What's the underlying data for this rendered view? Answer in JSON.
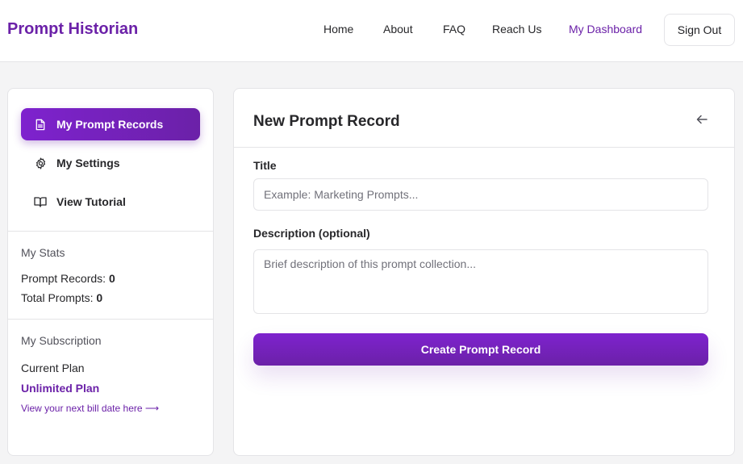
{
  "brand": "Prompt Historian",
  "nav": {
    "home": "Home",
    "about": "About",
    "faq": "FAQ",
    "reach_us": "Reach Us",
    "dashboard": "My Dashboard",
    "sign_out": "Sign Out"
  },
  "sidebar": {
    "items": [
      {
        "label": "My Prompt Records",
        "icon": "document-icon",
        "active": true
      },
      {
        "label": "My Settings",
        "icon": "gear-icon",
        "active": false
      },
      {
        "label": "View Tutorial",
        "icon": "book-icon",
        "active": false
      }
    ],
    "stats": {
      "title": "My Stats",
      "prompt_records_label": "Prompt Records:",
      "prompt_records_value": "0",
      "total_prompts_label": "Total Prompts:",
      "total_prompts_value": "0"
    },
    "subscription": {
      "title": "My Subscription",
      "current_plan_label": "Current Plan",
      "plan_name": "Unlimited Plan",
      "bill_link": "View your next bill date here ⟶"
    }
  },
  "form": {
    "title": "New Prompt Record",
    "title_field_label": "Title",
    "title_placeholder": "Example: Marketing Prompts...",
    "title_value": "",
    "description_label": "Description (optional)",
    "description_placeholder": "Brief description of this prompt collection...",
    "description_value": "",
    "submit_label": "Create Prompt Record"
  },
  "colors": {
    "accent": "#6b21a8",
    "background": "#f4f4f5",
    "border": "#e4e4e7"
  }
}
